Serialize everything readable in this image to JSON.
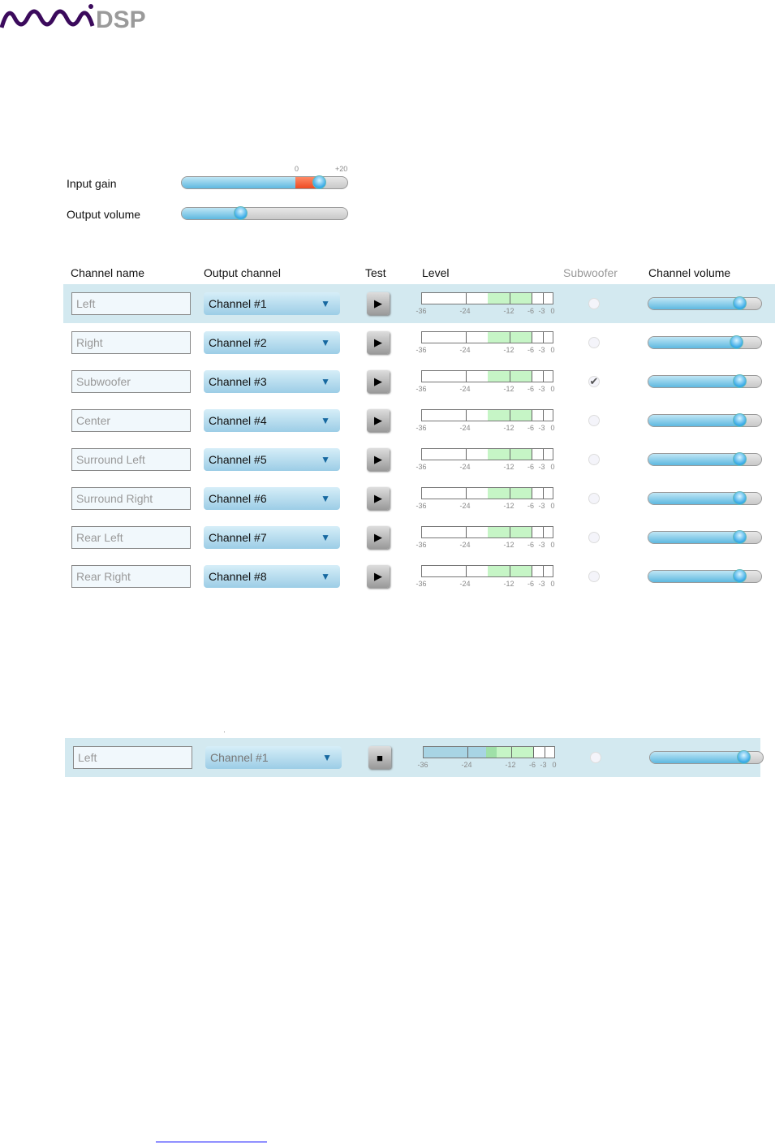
{
  "logo": {
    "text": "miniDSP"
  },
  "input_gain": {
    "label": "Input gain",
    "scale_min": "0",
    "scale_max": "+20",
    "value_fraction": 0.83,
    "boost_start_fraction": 0.68
  },
  "output_volume": {
    "label": "Output volume",
    "value_fraction": 0.36
  },
  "headers": {
    "channel_name": "Channel name",
    "output_channel": "Output channel",
    "test": "Test",
    "level": "Level",
    "subwoofer": "Subwoofer",
    "channel_volume": "Channel volume"
  },
  "meter_labels": [
    "-36",
    "-24",
    "-12",
    "-6",
    "-3",
    "0"
  ],
  "channels": [
    {
      "name": "Left",
      "output": "Channel #1",
      "subwoofer": false,
      "volume": 0.81,
      "selected": true
    },
    {
      "name": "Right",
      "output": "Channel #2",
      "subwoofer": false,
      "volume": 0.78
    },
    {
      "name": "Subwoofer",
      "output": "Channel #3",
      "subwoofer": true,
      "volume": 0.81
    },
    {
      "name": "Center",
      "output": "Channel #4",
      "subwoofer": false,
      "volume": 0.81
    },
    {
      "name": "Surround Left",
      "output": "Channel #5",
      "subwoofer": false,
      "volume": 0.81
    },
    {
      "name": "Surround Right",
      "output": "Channel #6",
      "subwoofer": false,
      "volume": 0.81
    },
    {
      "name": "Rear Left",
      "output": "Channel #7",
      "subwoofer": false,
      "volume": 0.81
    },
    {
      "name": "Rear Right",
      "output": "Channel #8",
      "subwoofer": false,
      "volume": 0.81
    }
  ],
  "playing_row": {
    "name": "Left",
    "output": "Channel #1",
    "subwoofer": false,
    "volume": 0.83,
    "level_db": -19
  },
  "colors": {
    "brand_purple": "#3b0a5c",
    "selection": "#d3e9f0",
    "meter_green": "#c6f5c6",
    "link": "#0000ff"
  }
}
